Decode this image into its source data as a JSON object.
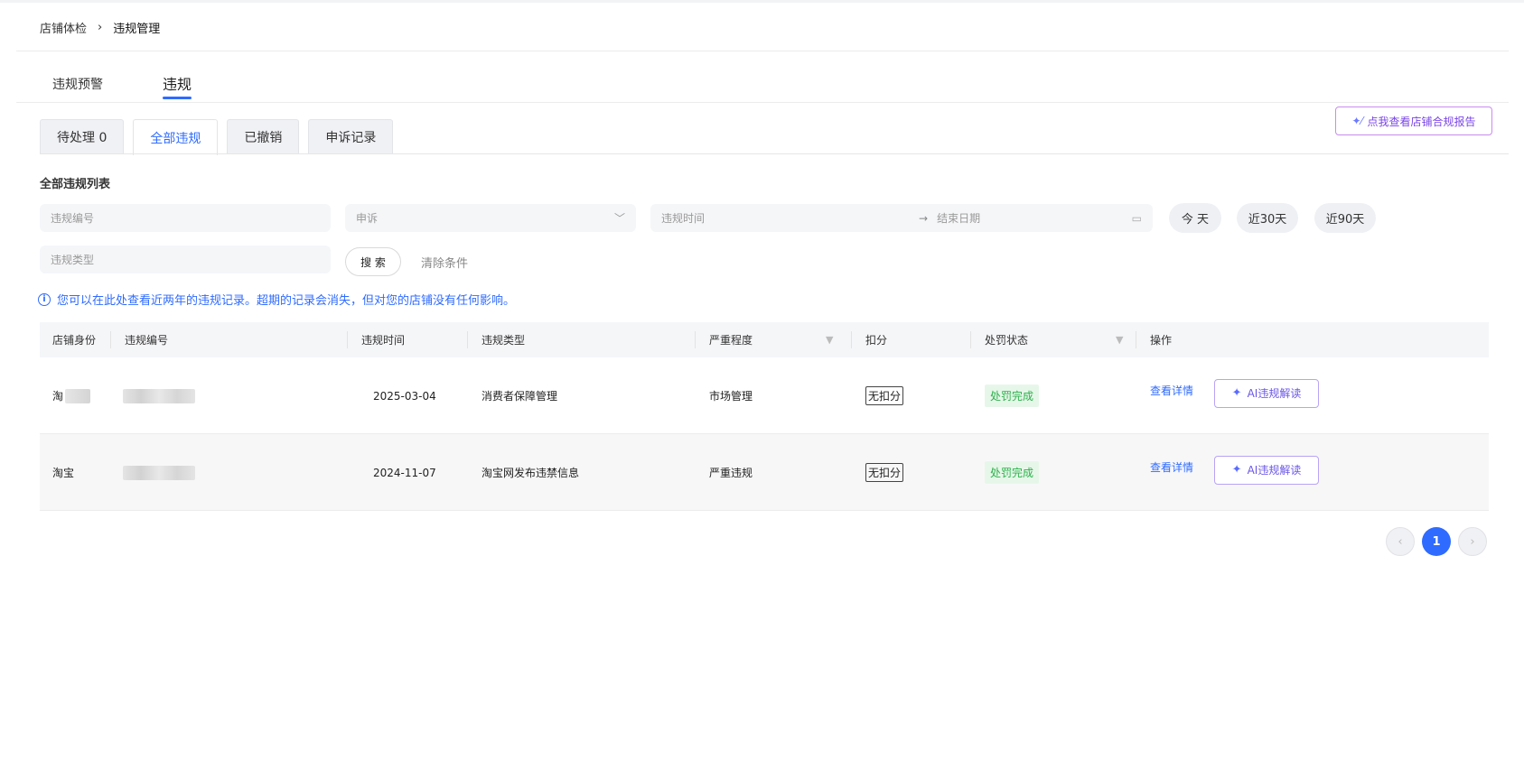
{
  "breadcrumb": {
    "parent": "店铺体检",
    "separator": "›",
    "current": "违规管理"
  },
  "main_tabs": [
    {
      "label": "违规预警",
      "active": false
    },
    {
      "label": "违规",
      "active": true
    }
  ],
  "sub_tabs": [
    {
      "label": "待处理 0",
      "active": false
    },
    {
      "label": "全部违规",
      "active": true
    },
    {
      "label": "已撤销",
      "active": false
    },
    {
      "label": "申诉记录",
      "active": false
    }
  ],
  "report_button": {
    "label": "点我查看店铺合规报告",
    "icon": "sparkle-icon"
  },
  "list_title": "全部违规列表",
  "filters": {
    "code_placeholder": "违规编号",
    "appeal_value": "申诉",
    "date_label": "违规时间",
    "date_arrow": "→",
    "date_end_placeholder": "结束日期",
    "type_placeholder": "违规类型",
    "quick_ranges": [
      "今 天",
      "近30天",
      "近90天"
    ],
    "search_label": "搜 索",
    "clear_label": "清除条件"
  },
  "notice": {
    "icon": "info-icon",
    "text": "您可以在此处查看近两年的违规记录。超期的记录会消失，但对您的店铺没有任何影响。"
  },
  "table": {
    "headers": [
      "店铺身份",
      "违规编号",
      "违规时间",
      "违规类型",
      "严重程度",
      "扣分",
      "处罚状态",
      "操作"
    ],
    "rows": [
      {
        "shop": "淘",
        "time": "2025-03-04",
        "type": "消费者保障管理",
        "severity": "市场管理",
        "deduct": "无扣分",
        "status": "处罚完成",
        "detail": "查看详情",
        "ai": "AI违规解读"
      },
      {
        "shop": "淘宝",
        "time": "2024-11-07",
        "type": "淘宝网发布违禁信息",
        "severity": "严重违规",
        "deduct": "无扣分",
        "status": "处罚完成",
        "detail": "查看详情",
        "ai": "AI违规解读"
      }
    ]
  },
  "pagination": {
    "prev": "‹",
    "current": "1",
    "next": "›"
  },
  "colors": {
    "accent": "#2f6bff",
    "status_green": "#2bb14a",
    "ai_purple": "#6a55e8"
  }
}
